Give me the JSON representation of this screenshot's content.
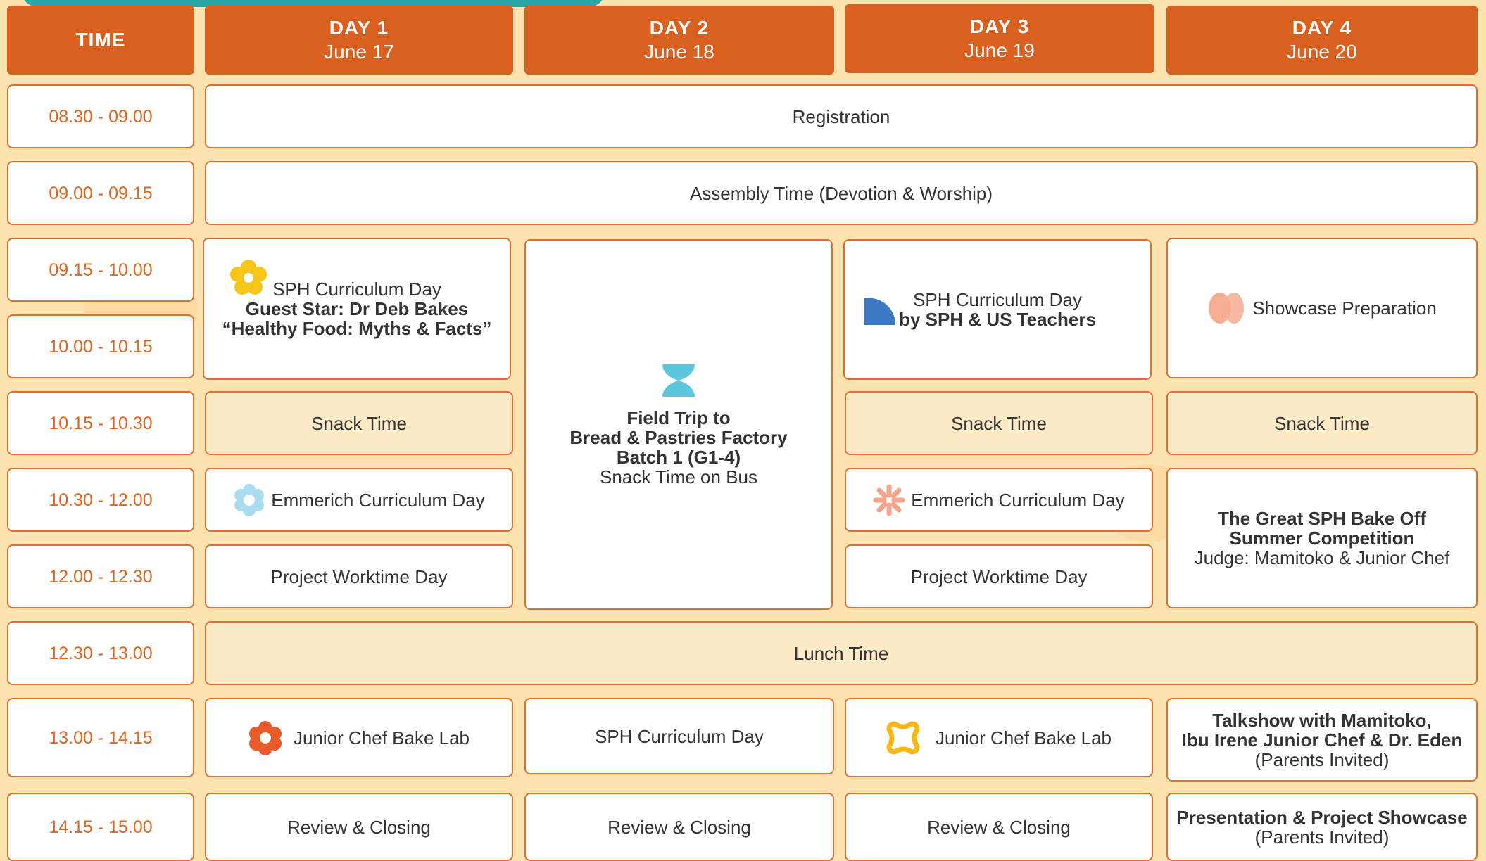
{
  "header": {
    "time_label": "TIME",
    "days": [
      {
        "day": "DAY 1",
        "date": "June 17"
      },
      {
        "day": "DAY 2",
        "date": "June 18"
      },
      {
        "day": "DAY 3",
        "date": "June 19"
      },
      {
        "day": "DAY 4",
        "date": "June 20"
      }
    ]
  },
  "times": [
    "08.30 - 09.00",
    "09.00 - 09.15",
    "09.15 - 10.00",
    "10.00 - 10.15",
    "10.15 - 10.30",
    "10.30 - 12.00",
    "12.00 - 12.30",
    "12.30 - 13.00",
    "13.00 - 14.15",
    "14.15 - 15.00"
  ],
  "events": {
    "registration": "Registration",
    "assembly": "Assembly Time (Devotion & Worship)",
    "d1_curr": {
      "l1": "SPH Curriculum Day",
      "l2": "Guest Star: Dr Deb Bakes",
      "l3": "“Healthy Food: Myths & Facts”"
    },
    "d2_trip": {
      "l1": "Field Trip to",
      "l2": "Bread & Pastries Factory",
      "l3": "Batch 1 (G1-4)",
      "l4": "Snack Time on Bus"
    },
    "d3_curr": {
      "l1": "SPH Curriculum Day",
      "l2": "by SPH & US Teachers"
    },
    "d4_prep": "Showcase Preparation",
    "snack": "Snack Time",
    "emmerich": "Emmerich Curriculum Day",
    "project": "Project Worktime Day",
    "bakeoff": {
      "l1": "The Great SPH Bake Off",
      "l2": "Summer Competition",
      "l3": "Judge: Mamitoko & Junior Chef"
    },
    "lunch": "Lunch Time",
    "bakelab": "Junior Chef Bake Lab",
    "d2_curr": "SPH Curriculum Day",
    "talkshow": {
      "l1": "Talkshow with Mamitoko,",
      "l2": "Ibu Irene Junior Chef & Dr. Eden",
      "l3": "(Parents Invited)"
    },
    "review": "Review & Closing",
    "presentation": {
      "l1": "Presentation & Project Showcase",
      "l2": "(Parents Invited)"
    }
  },
  "icons": {
    "d1_curr": "yellow-flower-icon",
    "d2_trip": "hourglass-icon",
    "d3_curr": "blue-quarter-shape-icon",
    "d4_prep": "peach-petals-icon",
    "d1_emmerich": "blue-flower-icon",
    "d3_emmerich": "peach-asterisk-icon",
    "d1_bakelab": "orange-flower-icon",
    "d3_bakelab": "yellow-squircle-icon"
  },
  "colors": {
    "header_bg": "#d9601f",
    "border": "#e0702f",
    "time_text": "#e0661f",
    "page_bg": "#fde3b0",
    "beige_cell": "#fdebc8"
  }
}
